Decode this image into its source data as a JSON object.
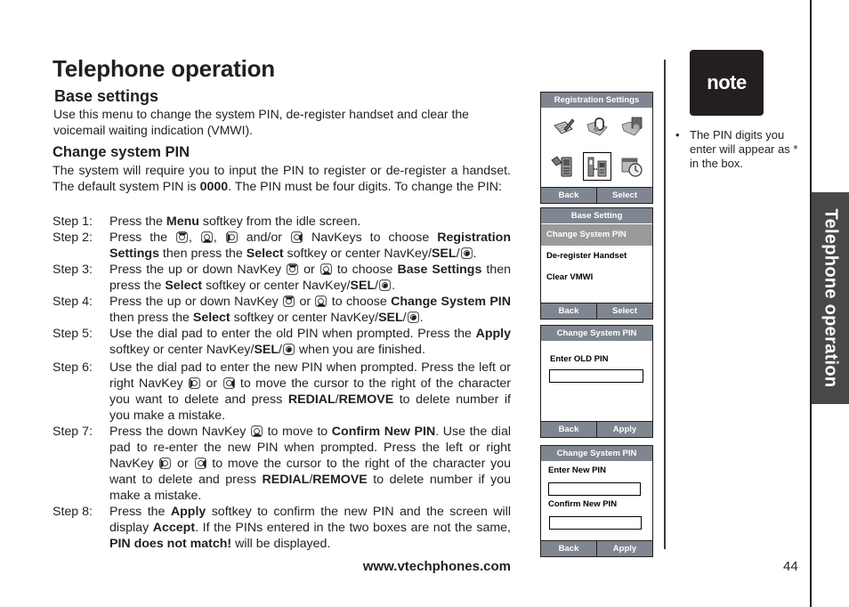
{
  "page": {
    "title": "Telephone operation",
    "section_title": "Base settings",
    "section_intro": "Use this menu to change the system PIN, de-register handset and clear the voicemail waiting indication (VMWI).",
    "subsection_title": "Change system PIN",
    "subsection_intro": {
      "a": "The system will require you to input the PIN to register or de-register a handset. The default system PIN is ",
      "b": "0000",
      "c": ". The PIN must be four digits. To change the PIN:"
    },
    "website": "www.vtechphones.com",
    "page_number": "44",
    "side_tab": "Telephone operation"
  },
  "steps": [
    {
      "label": "Step 1:",
      "parts": [
        "Press the ",
        "Menu",
        " softkey from the idle screen."
      ]
    },
    {
      "label": "Step 2:",
      "parts": [
        "Press the ",
        ", ",
        ", ",
        " and/or ",
        " NavKeys to choose ",
        "Registration Settings",
        " then press the ",
        "Select",
        " softkey or center NavKey/",
        "SEL",
        "/",
        "."
      ]
    },
    {
      "label": "Step 3:",
      "parts": [
        "Press the up or down NavKey ",
        " or ",
        " to choose ",
        "Base Settings",
        " then press the ",
        "Select",
        " softkey or center NavKey/",
        "SEL",
        "/",
        "."
      ]
    },
    {
      "label": "Step 4:",
      "parts": [
        "Press the up or down NavKey ",
        " or ",
        " to choose ",
        "Change System PIN",
        " then press the ",
        "Select",
        " softkey or center NavKey/",
        "SEL",
        "/",
        "."
      ]
    },
    {
      "label": "Step 5:",
      "parts": [
        "Use the dial pad to enter the old PIN when prompted. Press the ",
        "Apply",
        " softkey or center NavKey/",
        "SEL",
        "/",
        " when you are finished."
      ]
    },
    {
      "label": "Step 6:",
      "parts": [
        "Use the dial pad to enter the new PIN when prompted. Press the left or right NavKey ",
        " or ",
        " to move the cursor to the right of the character you want to delete and press ",
        "REDIAL",
        "/",
        "REMOVE",
        " to delete number if you make a mistake."
      ]
    },
    {
      "label": "Step 7:",
      "parts": [
        "Press the down NavKey ",
        " to move to ",
        "Confirm New PIN",
        ". Use the dial pad to re-enter the new PIN when prompted. Press the left or right NavKey ",
        " or ",
        " to move the cursor to the right of the character you want to delete and press ",
        "REDIAL",
        "/",
        "REMOVE",
        " to delete number if you make a mistake."
      ]
    },
    {
      "label": "Step 8:",
      "parts": [
        "Press the ",
        "Apply",
        " softkey to confirm the new PIN and the screen will display ",
        "Accept",
        ". If the PINs entered in the two boxes are not the same, ",
        "PIN does not match!",
        " will be displayed."
      ]
    }
  ],
  "note": {
    "badge": "note",
    "items": [
      "The PIN digits you enter will appear as * in the box."
    ]
  },
  "screens": {
    "registration": {
      "header": "Registration Settings",
      "icons": [
        "notepad-icon",
        "folder-music-icon",
        "folder-picture-icon",
        "handset-settings-icon",
        "registration-icon",
        "clock-icon"
      ],
      "selected_icon": 4,
      "left_softkey": "Back",
      "right_softkey": "Select"
    },
    "base_setting": {
      "header": "Base Setting",
      "items": [
        "Change System PIN",
        "De-register Handset",
        "Clear VMWI"
      ],
      "selected_index": 0,
      "left_softkey": "Back",
      "right_softkey": "Select"
    },
    "old_pin": {
      "header": "Change System PIN",
      "label": "Enter OLD PIN",
      "value": "",
      "left_softkey": "Back",
      "right_softkey": "Apply"
    },
    "new_pin": {
      "header": "Change System PIN",
      "label_new": "Enter New PIN",
      "value_new": "",
      "label_confirm": "Confirm New PIN",
      "value_confirm": "",
      "left_softkey": "Back",
      "right_softkey": "Apply"
    }
  },
  "colors": {
    "text": "#231f20",
    "screen_bar": "#7f8690",
    "side_tab": "#4a4748",
    "selected_row": "#9a9a9a"
  }
}
